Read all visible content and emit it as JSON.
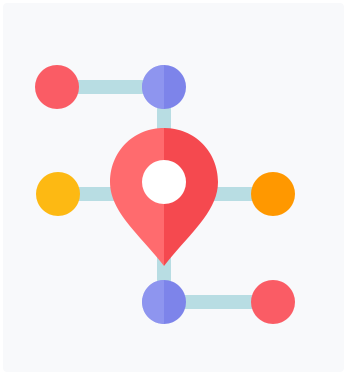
{
  "icon": {
    "name": "location-network-icon",
    "colors": {
      "background": "#f8f9fb",
      "connector": "#b8dde3",
      "red_node": "#fa5c65",
      "blue_node": "#7d84ea",
      "yellow_node": "#fdb913",
      "orange_node": "#ff9800",
      "pin_light": "#ff6b6e",
      "pin_dark": "#f5494f",
      "pin_hole": "#ffffff"
    }
  }
}
